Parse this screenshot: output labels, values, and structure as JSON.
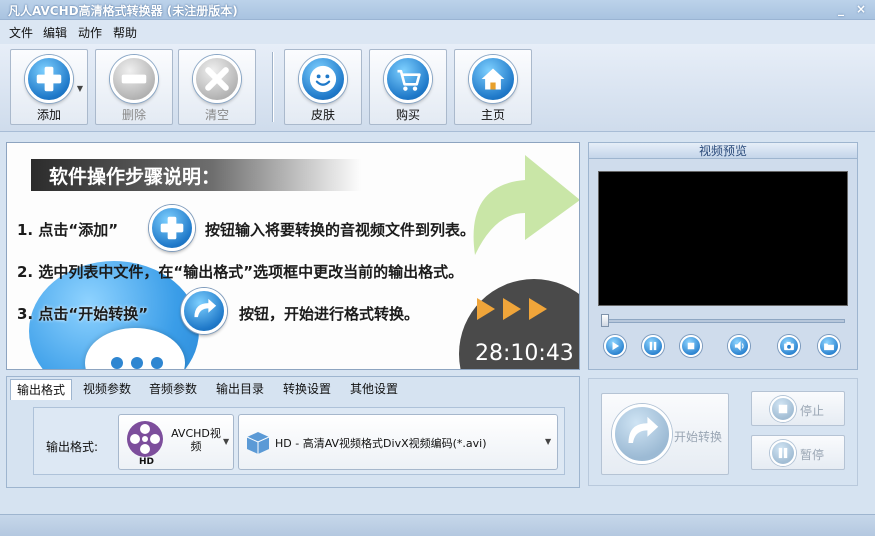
{
  "window": {
    "title": "凡人AVCHD高清格式转换器  (未注册版本)",
    "minimize_glyph": "_",
    "close_glyph": "×"
  },
  "menu": [
    "文件",
    "编辑",
    "动作",
    "帮助"
  ],
  "toolbar": {
    "add": "添加",
    "delete": "删除",
    "clear": "清空",
    "skin": "皮肤",
    "buy": "购买",
    "home": "主页"
  },
  "banner": {
    "heading": "软件操作步骤说明：",
    "step1_a": "1. 点击“添加”",
    "step1_b": "按钮输入将要转换的音视频文件到列表。",
    "step2": "2. 选中列表中文件，在“输出格式”选项框中更改当前的输出格式。",
    "step3_a": "3. 点击“开始转换”",
    "step3_b": "按钮，开始进行格式转换。",
    "timer": "28:10:43"
  },
  "preview": {
    "title": "视频预览"
  },
  "tabs": [
    "输出格式",
    "视频参数",
    "音频参数",
    "输出目录",
    "转换设置",
    "其他设置"
  ],
  "output": {
    "label": "输出格式:",
    "category_line1": "AVCHD视",
    "category_line2": "频",
    "hd_badge": "HD",
    "format": "HD - 高清AV视频格式DivX视频编码(*.avi)"
  },
  "actions": {
    "start": "开始转换",
    "stop": "停止",
    "pause": "暂停"
  },
  "colors": {
    "accent_blue": "#1f79c9",
    "panel_bg": "#d6e3f1",
    "disabled_text": "#9aa6b4"
  }
}
